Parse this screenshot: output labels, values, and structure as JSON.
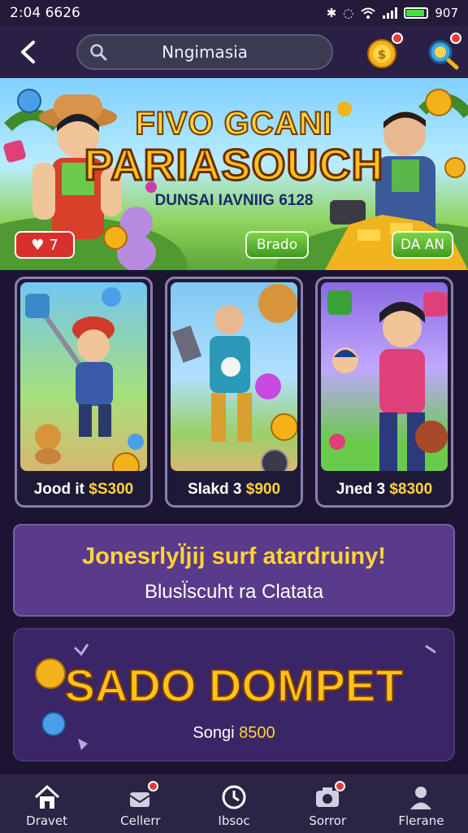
{
  "status_bar": {
    "time": "2:04 6626",
    "battery_label": "907",
    "battery_level": 0.85
  },
  "header": {
    "search_value": "Nngimasia"
  },
  "banner": {
    "title_line1": "FIVO GCANI",
    "title_line2": "PARIASOUCH",
    "subtitle": "DUNSAI IAVNIIG 6128",
    "likes_count": "7",
    "left_button": "Brado",
    "right_button": "DA AN"
  },
  "cards": [
    {
      "label": "Jood it",
      "price": "$S300"
    },
    {
      "label": "Slakd 3",
      "price": "$900"
    },
    {
      "label": "Jned 3",
      "price": "$8300"
    }
  ],
  "promo": {
    "title": "Jonesrlyl̈jij surf atardruiny!",
    "subtitle": "Blusl̈scuht ra Clatata"
  },
  "wallet": {
    "title": "SADO DOMPET",
    "sub_label": "Songi",
    "sub_value": "8500"
  },
  "nav": [
    {
      "label": "Dravet",
      "icon": "home-icon",
      "badge": false
    },
    {
      "label": "Cellerr",
      "icon": "gift-icon",
      "badge": true
    },
    {
      "label": "Ibsoc",
      "icon": "clock-icon",
      "badge": false
    },
    {
      "label": "Sorror",
      "icon": "camera-icon",
      "badge": true
    },
    {
      "label": "Flerane",
      "icon": "user-icon",
      "badge": false
    }
  ],
  "colors": {
    "accent_gold": "#ffd23c",
    "background": "#1c1430",
    "panel_purple": "#5a3a8a",
    "badge_red": "#e43b3b"
  }
}
